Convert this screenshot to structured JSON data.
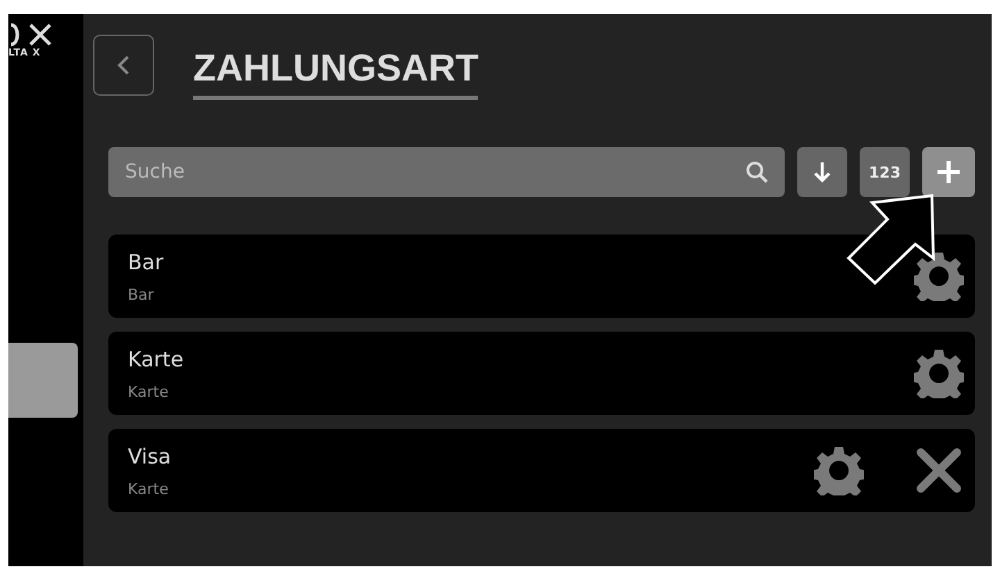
{
  "logo": {
    "caption": "LTA X"
  },
  "sidebar": {
    "items": [
      {
        "kind": "tab",
        "selected": true
      }
    ]
  },
  "header": {
    "title": "ZAHLUNGSART"
  },
  "search": {
    "placeholder": "Suche"
  },
  "toolbar": [
    {
      "kind": "sort"
    },
    {
      "kind": "number",
      "label": "123"
    },
    {
      "kind": "add"
    }
  ],
  "items": [
    {
      "title": "Bar",
      "subtitle": "Bar",
      "deletable": false
    },
    {
      "title": "Karte",
      "subtitle": "Karte",
      "deletable": false
    },
    {
      "title": "Visa",
      "subtitle": "Karte",
      "deletable": true
    }
  ],
  "annotation": {
    "kind": "arrow"
  }
}
